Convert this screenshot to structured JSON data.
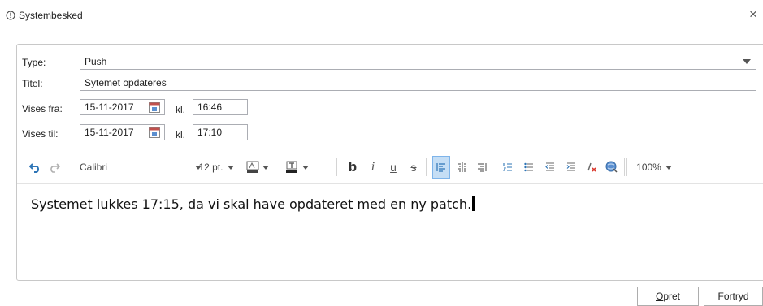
{
  "dialog": {
    "title": "Systembesked",
    "close_label": "×",
    "title_icon": "info-icon"
  },
  "form": {
    "type_label": "Type:",
    "type_value": "Push",
    "title_label": "Titel:",
    "title_value": "Sytemet opdateres",
    "from_label": "Vises fra:",
    "from_date": "15-11-2017",
    "from_kl_label": "kl.",
    "from_time": "16:46",
    "to_label": "Vises til:",
    "to_date": "15-11-2017",
    "to_kl_label": "kl.",
    "to_time": "17:10"
  },
  "toolbar": {
    "font": "Calibri",
    "size": "12 pt.",
    "zoom": "100%",
    "bold": "b",
    "italic": "i",
    "underline": "u",
    "strike": "s"
  },
  "editor": {
    "text": "Systemet lukkes 17:15, da vi skal have opdateret med en ny patch."
  },
  "buttons": {
    "create_underlined": "O",
    "create_rest": "pret",
    "cancel": "Fortryd"
  },
  "colors": {
    "accent": "#2e75b6",
    "selected_bg": "#c5def5",
    "border": "#abadb3"
  }
}
